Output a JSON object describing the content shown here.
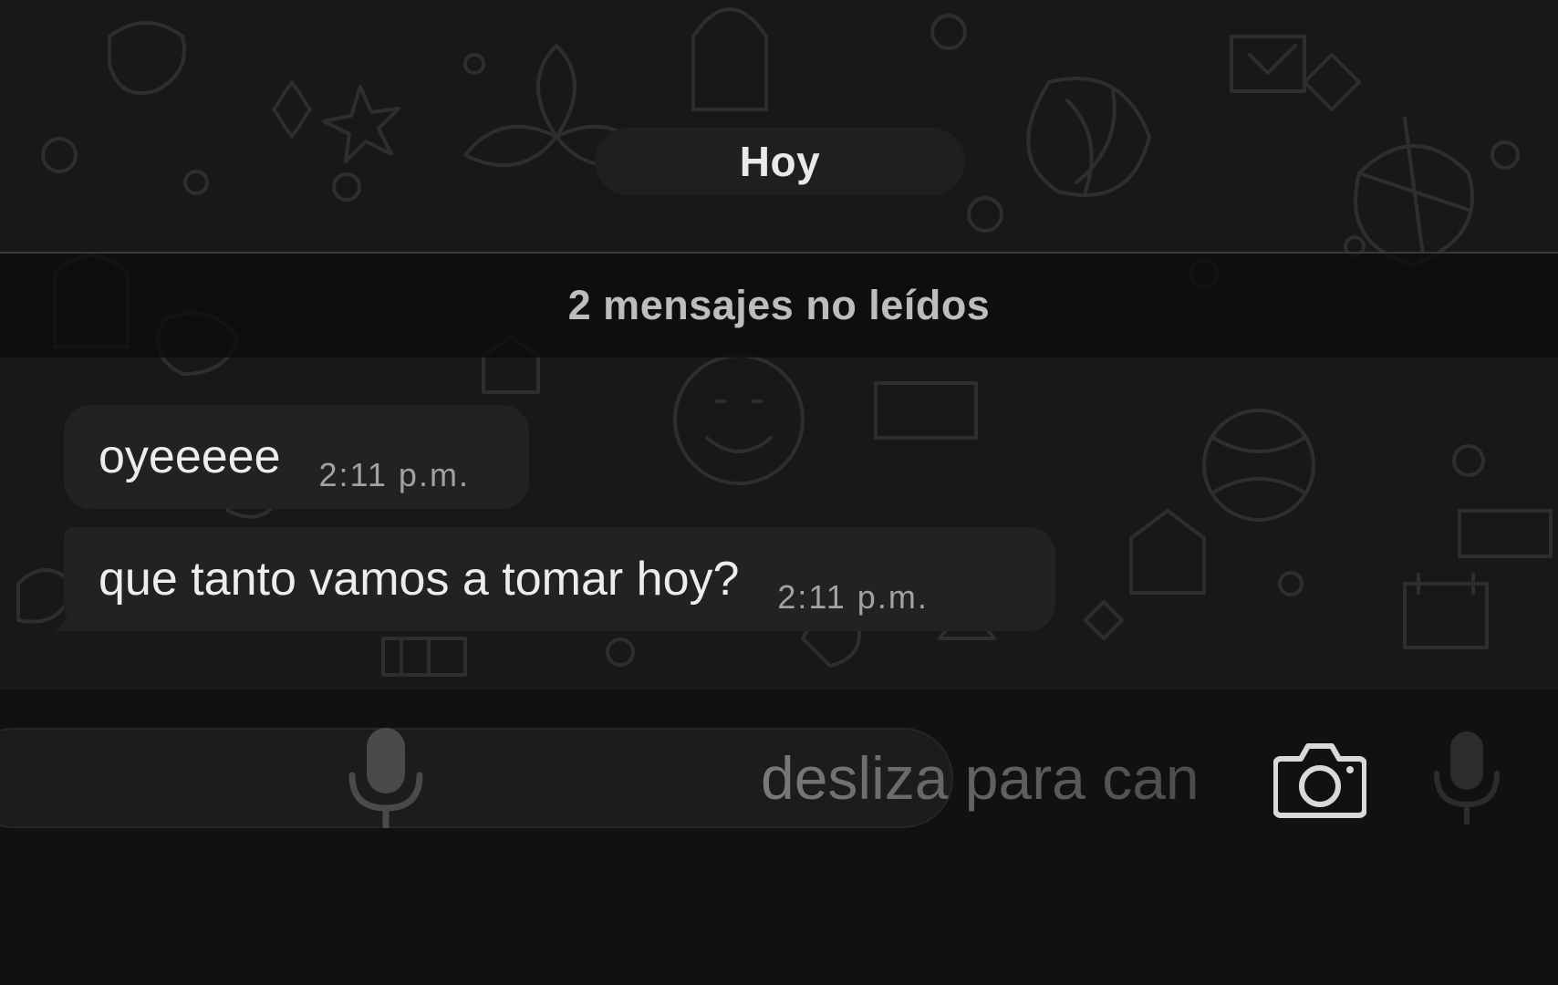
{
  "chat": {
    "date_separator": "Hoy",
    "unread_banner": "2 mensajes no leídos",
    "messages": [
      {
        "text": "oyeeeee",
        "time": "2:11 p.m."
      },
      {
        "text": "que tanto vamos a tomar hoy?",
        "time": "2:11 p.m."
      }
    ]
  },
  "composer": {
    "slide_to_cancel": "desliza para can",
    "icons": {
      "recording_mic": "mic-icon",
      "camera": "camera-icon",
      "mic": "mic-icon"
    }
  },
  "colors": {
    "background": "#111111",
    "chat_wallpaper": "#181818",
    "bubble": "#222222",
    "text": "#ededed",
    "timestamp": "#a2a2a2"
  }
}
